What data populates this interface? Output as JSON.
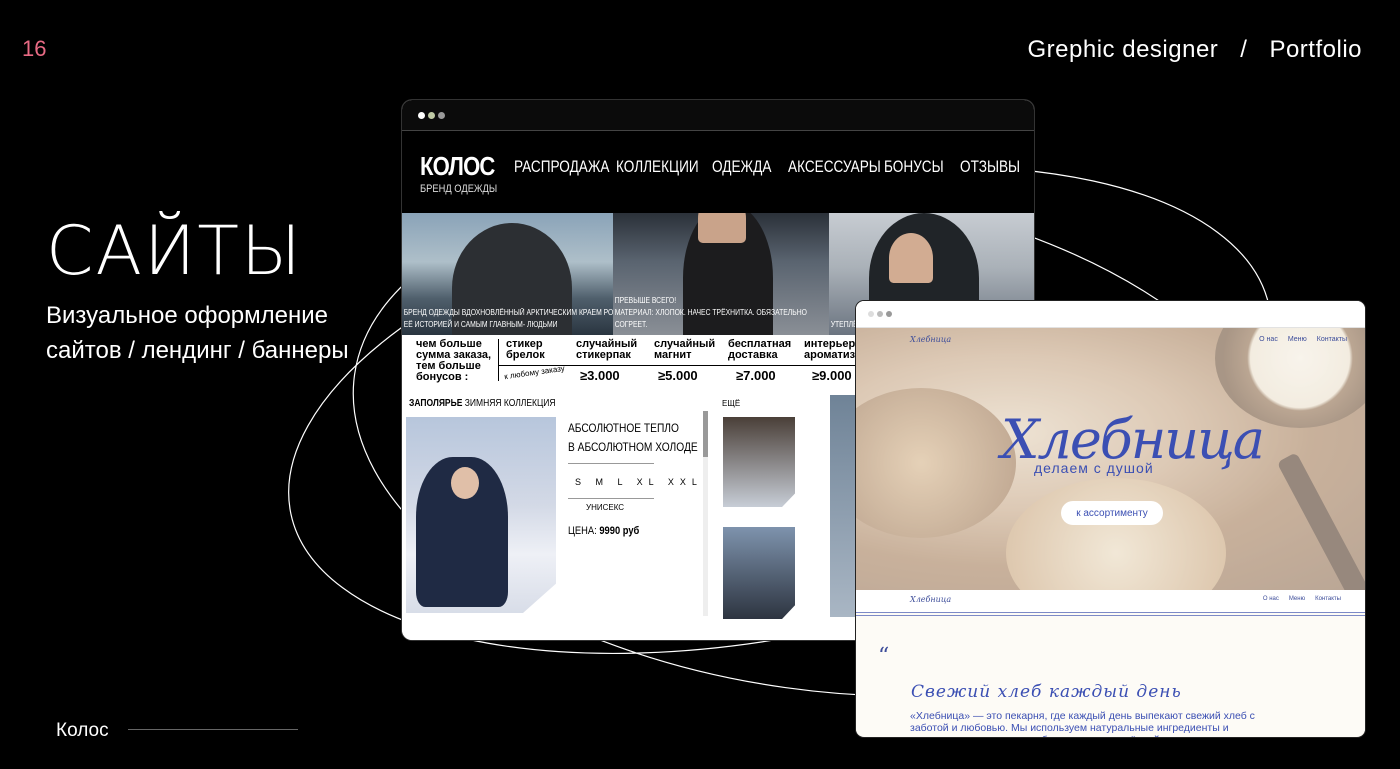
{
  "page_number": "16",
  "header": {
    "role": "Grephic designer",
    "separator": "/",
    "section": "Portfolio"
  },
  "title": "САЙТЫ",
  "subtitle": {
    "line1": "Визуальное оформление",
    "line2": "сайтов / лендинг  /  баннеры"
  },
  "footer": {
    "label": "Колос"
  },
  "kolos": {
    "logo": "КОЛОС",
    "logo_sub": "БРЕНД ОДЕЖДЫ",
    "menu": [
      "РАСПРОДАЖА",
      "КОЛЛЕКЦИИ",
      "ОДЕЖДА",
      "АКСЕССУАРЫ",
      "БОНУСЫ",
      "ОТЗЫВЫ"
    ],
    "captions": [
      "БРЕНД ОДЕЖДЫ ВДОХНОВЛЁННЫЙ АРКТИЧЕСКИМ КРАЕМ РОССИИ",
      "ЕЁ ИСТОРИЕЙ И САМЫМ ГЛАВНЫМ- ЛЮДЬМИ",
      "ПРЕВЫШЕ ВСЕГО!",
      "МАТЕРИАЛ: ХЛОПОК. НАЧЕС ТРЁХНИТКА. ОБЯЗАТЕЛЬНО",
      "СОГРЕЕТ.",
      "УТЕПЛЁННАЯ УШАНКА"
    ],
    "bonus": {
      "left": [
        "чем больше",
        "сумма заказа,",
        "тем больше",
        "бонусов :"
      ],
      "columns": [
        {
          "label": [
            "стикер",
            "брелок"
          ],
          "value": "к любому заказу"
        },
        {
          "label": [
            "случайный",
            "стикерпак"
          ],
          "value": "≥3.000"
        },
        {
          "label": [
            "случайный",
            "магнит"
          ],
          "value": "≥5.000"
        },
        {
          "label": [
            "бесплатная",
            "доставка"
          ],
          "value": "≥7.000"
        },
        {
          "label": [
            "интерьерн",
            "ароматиз"
          ],
          "value": "≥9.000"
        }
      ]
    },
    "shop": {
      "collection_name": "ЗАПОЛЯРЬЕ",
      "collection_sub": "ЗИМНЯЯ КОЛЛЕКЦИЯ",
      "desc_line1": "АБСОЛЮТНОЕ ТЕПЛО",
      "desc_line2": "В АБСОЛЮТНОМ ХОЛОДЕ",
      "sizes": "S M L XL XXL",
      "unisex": "УНИСЕКС",
      "price_label": "ЦЕНА:",
      "price_value": "9990 руб",
      "more": "ЕЩЁ"
    }
  },
  "hlebnitsa": {
    "nav": [
      "О нас",
      "Меню",
      "Контакты"
    ],
    "brand": "Хлебница",
    "tagline": "делаем с душой",
    "button": "к ассортименту",
    "quote_mark": "“",
    "heading": "Свежий  хлеб  каждый  день",
    "paragraph": "«Хлебница» — это пекарня, где каждый день выпекают свежий хлеб с заботой и любовью. Мы используем натуральные ингредиенты и проверенные рецепты, чтобы радовать вас тёплой,"
  },
  "colors": {
    "accent_page_number": "#e86a84",
    "hlebnitsa_blue": "#3b4fb3",
    "background": "#000000"
  }
}
